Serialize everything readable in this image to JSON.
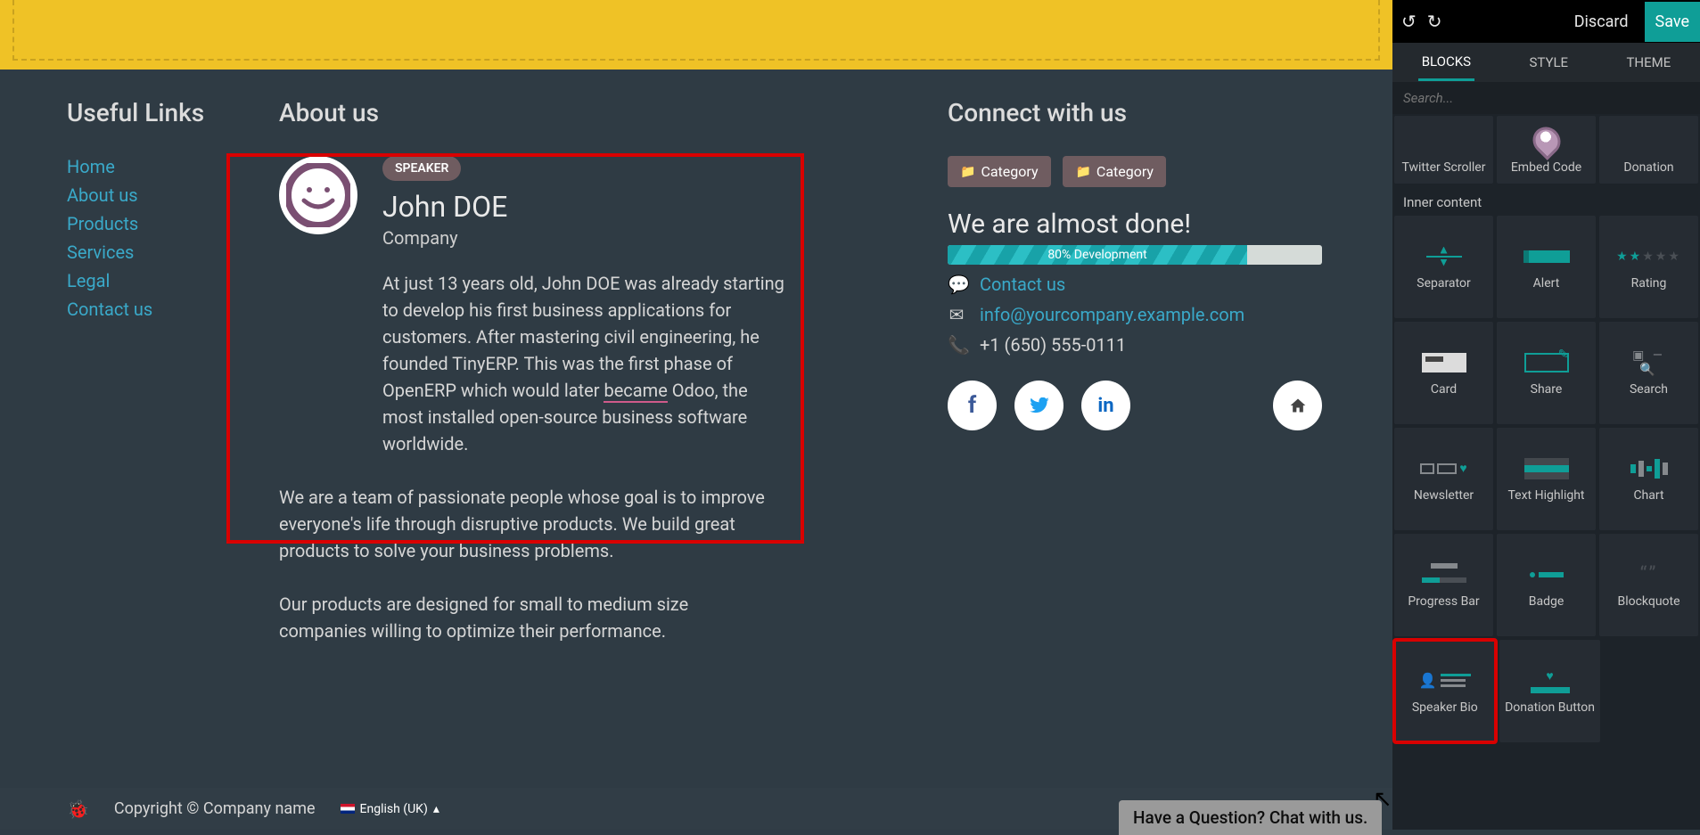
{
  "yellow_section": {},
  "main": {
    "useful_links": {
      "title": "Useful Links",
      "items": [
        "Home",
        "About us",
        "Products",
        "Services",
        "Legal",
        "Contact us"
      ]
    },
    "about_us": {
      "title": "About us",
      "speaker": {
        "badge": "SPEAKER",
        "name": "John DOE",
        "company": "Company",
        "bio_pre": "At just 13 years old, John DOE was already starting to develop his first business applications for customers. After mastering civil engineering, he founded TinyERP. This was the first phase of OpenERP which would later ",
        "bio_misspell": "became",
        "bio_post": " Odoo, the most installed open-source business software worldwide."
      },
      "para1": "We are a team of passionate people whose goal is to improve everyone's life through disruptive products. We build great products to solve your business problems.",
      "para2": "Our products are designed for small to medium size companies willing to optimize their performance."
    },
    "connect": {
      "title": "Connect with us",
      "cat1": "Category",
      "cat2": "Category",
      "headline": "We are almost done!",
      "progress": {
        "pct": 80,
        "label": "80% Development"
      },
      "contact_link": "Contact us",
      "email": "info@yourcompany.example.com",
      "phone": "+1 (650) 555-0111",
      "socials": [
        "facebook",
        "twitter",
        "linkedin",
        "home"
      ]
    }
  },
  "footer": {
    "copyright": "Copyright © Company name",
    "language": "English (UK)"
  },
  "chat": {
    "text": "Have a Question? Chat with us."
  },
  "sidebar": {
    "top": {
      "discard": "Discard",
      "save": "Save"
    },
    "tabs": {
      "blocks": "BLOCKS",
      "style": "STYLE",
      "theme": "THEME",
      "active": "blocks"
    },
    "search_placeholder": "Search...",
    "dynamic_row": [
      "Twitter Scroller",
      "Embed Code",
      "Donation"
    ],
    "inner_label": "Inner content",
    "inner_items": [
      "Separator",
      "Alert",
      "Rating",
      "Card",
      "Share",
      "Search",
      "Newsletter",
      "Text Highlight",
      "Chart",
      "Progress Bar",
      "Badge",
      "Blockquote",
      "Speaker Bio",
      "Donation Button"
    ]
  }
}
